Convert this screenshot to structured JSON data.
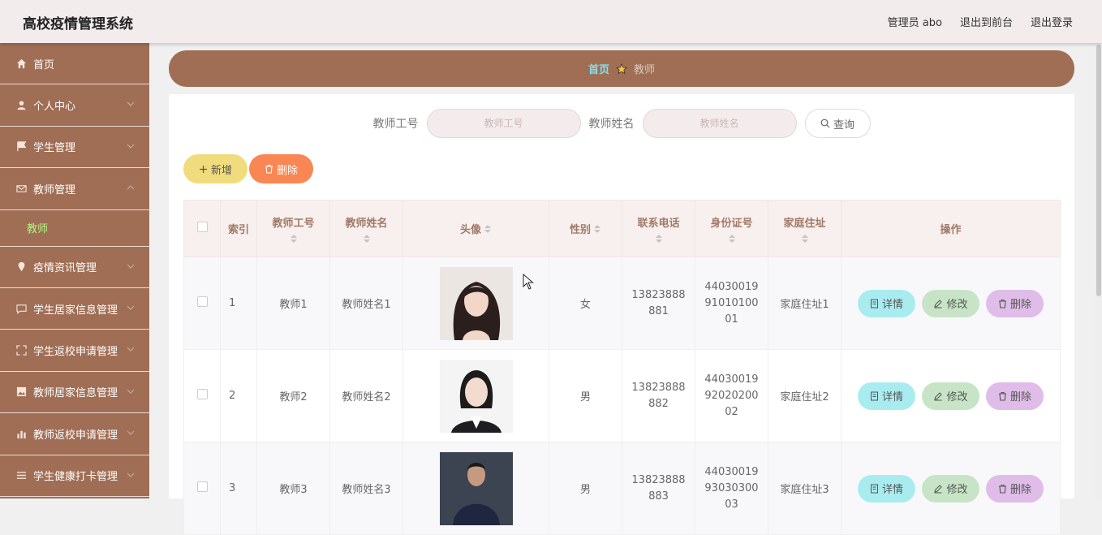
{
  "header": {
    "title": "高校疫情管理系统",
    "user": "管理员 abo",
    "to_front": "退出到前台",
    "logout": "退出登录"
  },
  "sidebar": {
    "items": [
      {
        "label": "首页",
        "icon": "home-icon"
      },
      {
        "label": "个人中心",
        "icon": "user-icon"
      },
      {
        "label": "学生管理",
        "icon": "flag-icon"
      },
      {
        "label": "教师管理",
        "icon": "mail-icon",
        "expanded": true
      },
      {
        "label": "疫情资讯管理",
        "icon": "location-icon"
      },
      {
        "label": "学生居家信息管理",
        "icon": "chat-icon"
      },
      {
        "label": "学生返校申请管理",
        "icon": "fullscreen-icon"
      },
      {
        "label": "教师居家信息管理",
        "icon": "picture-icon"
      },
      {
        "label": "教师返校申请管理",
        "icon": "chart-icon"
      },
      {
        "label": "学生健康打卡管理",
        "icon": "menu-icon"
      }
    ],
    "sub_item": "教师"
  },
  "breadcrumb": {
    "home": "首页",
    "current": "教师"
  },
  "search": {
    "field1_label": "教师工号",
    "field1_placeholder": "教师工号",
    "field2_label": "教师姓名",
    "field2_placeholder": "教师姓名",
    "query_label": "查询"
  },
  "actions": {
    "add_label": "新增",
    "delete_label": "删除"
  },
  "table": {
    "headers": {
      "index": "索引",
      "teacher_no": "教师工号",
      "teacher_name": "教师姓名",
      "avatar": "头像",
      "gender": "性别",
      "phone": "联系电话",
      "id_card": "身份证号",
      "address": "家庭住址",
      "ops": "操作"
    },
    "op_labels": {
      "detail": "详情",
      "edit": "修改",
      "delete": "删除"
    },
    "rows": [
      {
        "index": "1",
        "teacher_no": "教师1",
        "teacher_name": "教师姓名1",
        "gender": "女",
        "phone": "13823888881",
        "id_card": "440300199101010001",
        "address": "家庭住址1"
      },
      {
        "index": "2",
        "teacher_no": "教师2",
        "teacher_name": "教师姓名2",
        "gender": "男",
        "phone": "13823888882",
        "id_card": "440300199202020002",
        "address": "家庭住址2"
      },
      {
        "index": "3",
        "teacher_no": "教师3",
        "teacher_name": "教师姓名3",
        "gender": "男",
        "phone": "13823888883",
        "id_card": "440300199303030003",
        "address": "家庭住址3"
      }
    ]
  },
  "colors": {
    "sidebar_bg": "#a06e55",
    "accent_green": "#b9f089",
    "crumb_home": "#7fe0f0"
  }
}
